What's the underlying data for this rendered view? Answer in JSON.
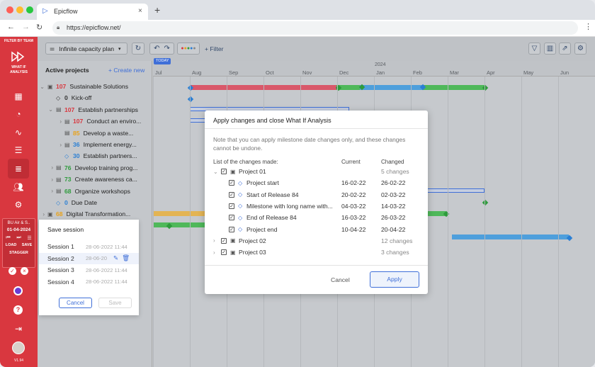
{
  "browser": {
    "tab_title": "Epicflow",
    "url": "https://epicflow.net/"
  },
  "sidebar": {
    "filter_label": "FILTER BY TEAM",
    "whatif_label_1": "WHAT IF",
    "whatif_label_2": "ANALYSIS",
    "team_name": "BU Air & S..",
    "date": "01-04-2024",
    "load_label": "LOAD",
    "save_label": "SAVE",
    "stagger_label": "STAGGER",
    "version": "V1.94"
  },
  "toolbar": {
    "plan_label": "Infinite capacity plan",
    "filter_label": "+ Filter",
    "today_label": "TODAY"
  },
  "panel": {
    "title": "Active projects",
    "create_label": "+ Create new"
  },
  "tree": [
    {
      "num": "107",
      "label": "Sustainable Solutions",
      "num_color": "#d9373f",
      "indent": 10,
      "expand": "⌄",
      "icon": "folder"
    },
    {
      "num": "0",
      "label": "Kick-off",
      "num_color": "#333",
      "indent": 22,
      "expand": "",
      "icon": "diamond"
    },
    {
      "num": "107",
      "label": "Establish partnerships",
      "num_color": "#d9373f",
      "indent": 22,
      "expand": "⌄",
      "icon": "doc"
    },
    {
      "num": "107",
      "label": "Conduct an enviro...",
      "num_color": "#d9373f",
      "indent": 34,
      "expand": "›",
      "icon": "doc"
    },
    {
      "num": "85",
      "label": "Develop a waste...",
      "num_color": "#e9a21a",
      "indent": 34,
      "expand": "",
      "icon": "doc"
    },
    {
      "num": "36",
      "label": "Implement energy...",
      "num_color": "#2a7fd4",
      "indent": 34,
      "expand": "›",
      "icon": "doc"
    },
    {
      "num": "30",
      "label": "Establish partners...",
      "num_color": "#2a7fd4",
      "indent": 34,
      "expand": "",
      "icon": "diamond-blue"
    },
    {
      "num": "76",
      "label": "Develop training prog...",
      "num_color": "#2e9b3c",
      "indent": 22,
      "expand": "›",
      "icon": "doc"
    },
    {
      "num": "73",
      "label": "Create awareness ca...",
      "num_color": "#2e9b3c",
      "indent": 22,
      "expand": "›",
      "icon": "doc"
    },
    {
      "num": "68",
      "label": "Organize workshops",
      "num_color": "#2e9b3c",
      "indent": 22,
      "expand": "›",
      "icon": "doc"
    },
    {
      "num": "0",
      "label": "Due Date",
      "num_color": "#2a7fd4",
      "indent": 22,
      "expand": "",
      "icon": "diamond-blue"
    },
    {
      "num": "68",
      "label": "Digital Transformation...",
      "num_color": "#e9a21a",
      "indent": 10,
      "expand": "›",
      "icon": "folder"
    }
  ],
  "gantt": {
    "year": "2024",
    "months": [
      "Jul",
      "Aug",
      "Sep",
      "Oct",
      "Nov",
      "Dec",
      "Jan",
      "Feb",
      "Mar",
      "Apr",
      "May",
      "Jun"
    ]
  },
  "dialog": {
    "title": "Apply changes and close What If Analysis",
    "note": "Note that you can apply milestone date changes only, and these changes cannot be undone.",
    "col_list": "List of the changes made:",
    "col_current": "Current",
    "col_changed": "Changed",
    "rows": [
      {
        "label": "Project 01",
        "current": "",
        "changed": "5 changes",
        "level": 0,
        "expand": "⌄"
      },
      {
        "label": "Project start",
        "current": "16-02-22",
        "changed": "26-02-22",
        "level": 1,
        "expand": ""
      },
      {
        "label": "Start of Release 84",
        "current": "20-02-22",
        "changed": "02-03-22",
        "level": 1,
        "expand": ""
      },
      {
        "label": "Milestone with long name with...",
        "current": "04-03-22",
        "changed": "14-03-22",
        "level": 1,
        "expand": ""
      },
      {
        "label": "End of Release 84",
        "current": "16-03-22",
        "changed": "26-03-22",
        "level": 1,
        "expand": ""
      },
      {
        "label": "Project end",
        "current": "10-04-22",
        "changed": "20-04-22",
        "level": 1,
        "expand": ""
      },
      {
        "label": "Project 02",
        "current": "",
        "changed": "12 changes",
        "level": 0,
        "expand": "›"
      },
      {
        "label": "Project 03",
        "current": "",
        "changed": "3 changes",
        "level": 0,
        "expand": "›"
      }
    ],
    "cancel_label": "Cancel",
    "apply_label": "Apply"
  },
  "session": {
    "title": "Save session",
    "rows": [
      {
        "label": "Session 1",
        "date": "28-06-2022 11:44"
      },
      {
        "label": "Session 2",
        "date": "28-06-20"
      },
      {
        "label": "Session 3",
        "date": "28-06-2022 11:44"
      },
      {
        "label": "Session 4",
        "date": "28-06-2022 11:44"
      }
    ],
    "cancel_label": "Cancel",
    "save_label": "Save"
  },
  "colors": {
    "accent": "#d9373f",
    "blue": "#3f6fd8",
    "bar_red": "#d9586a",
    "bar_green": "#4fb85a",
    "bar_blue": "#4e9fdc",
    "bar_orange": "#e3b454"
  }
}
